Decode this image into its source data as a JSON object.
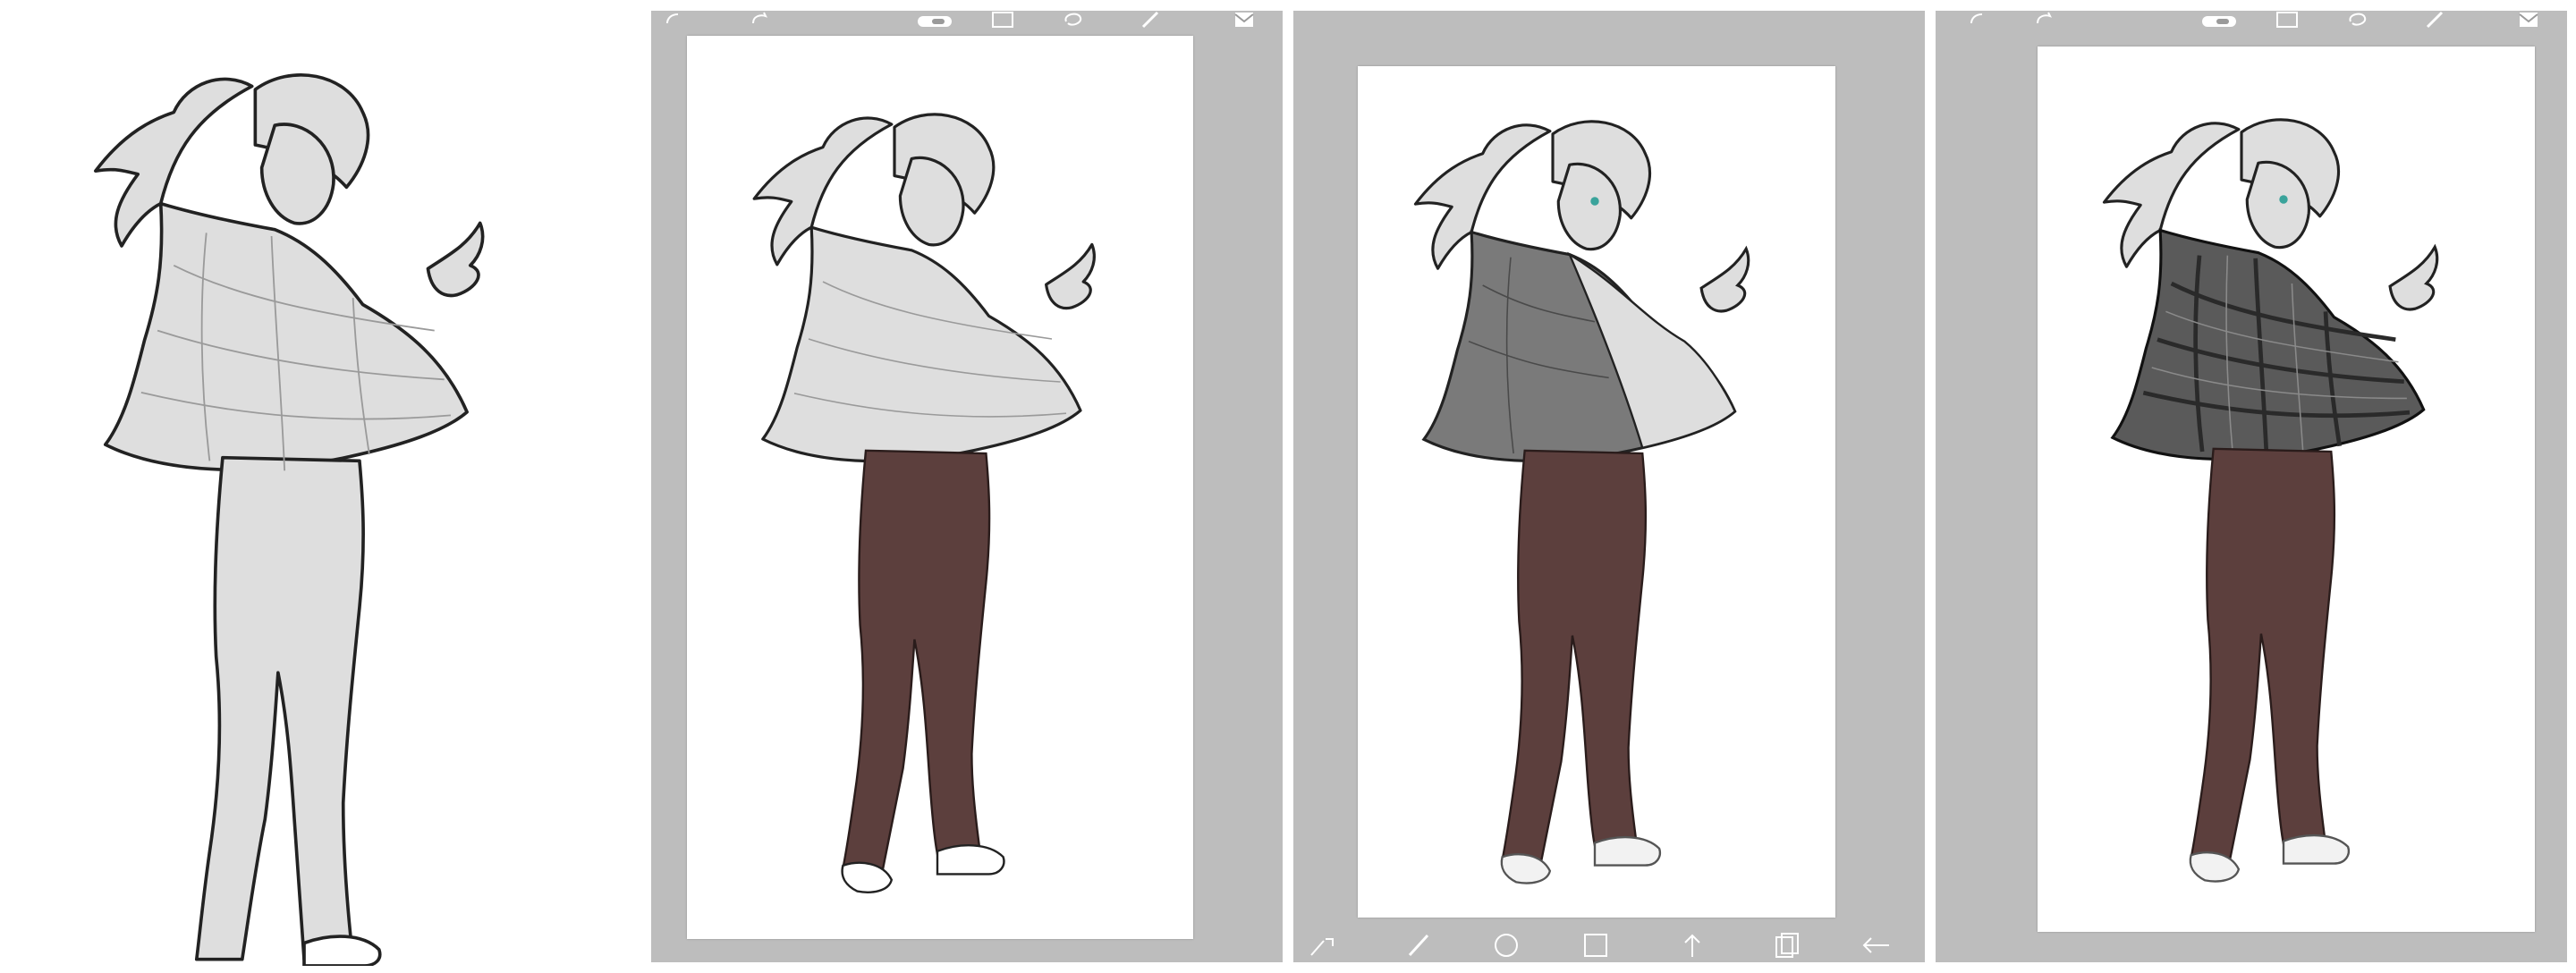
{
  "page": {
    "title": ""
  },
  "colors": {
    "workspace": "#bdbdbd",
    "canvas": "#ffffff",
    "line_art": "#222222",
    "base_fill": "#dedede",
    "pants": "#5c3f3d",
    "jacket_shade": "#5a5a5a",
    "accent_eye": "#3aa39b"
  },
  "panels": [
    {
      "id": "lineart",
      "stage": "line-art"
    },
    {
      "id": "flat-pants",
      "stage": "pants-colored",
      "toolbar_top": [
        "undo-icon",
        "redo-icon",
        "toggle-icon",
        "select-icon",
        "lasso-icon",
        "pen-icon",
        "layers-icon"
      ]
    },
    {
      "id": "shading",
      "stage": "jacket-shading",
      "toolbar_bottom": [
        "brush-settings-icon",
        "brush-icon",
        "ellipse-icon",
        "rectangle-icon",
        "transform-icon",
        "copy-icon",
        "back-icon"
      ]
    },
    {
      "id": "final",
      "stage": "jacket-plaid",
      "toolbar_top": [
        "undo-icon",
        "redo-icon",
        "toggle-icon",
        "select-icon",
        "lasso-icon",
        "pen-icon",
        "layers-icon"
      ]
    }
  ]
}
